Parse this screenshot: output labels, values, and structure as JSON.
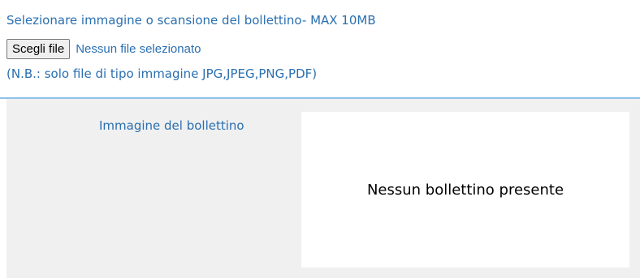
{
  "upload": {
    "title": "Selezionare immagine o scansione del bollettino- MAX 10MB",
    "button_label": "Scegli file",
    "file_status": "Nessun file selezionato",
    "note": "(N.B.: solo file di tipo immagine JPG,JPEG,PNG,PDF)"
  },
  "preview": {
    "label": "Immagine del bollettino",
    "empty_message": "Nessun bollettino presente"
  },
  "colors": {
    "label_blue": "#2a6fb0",
    "divider": "#8fc1e8",
    "panel_background": "#f0f0f0"
  }
}
